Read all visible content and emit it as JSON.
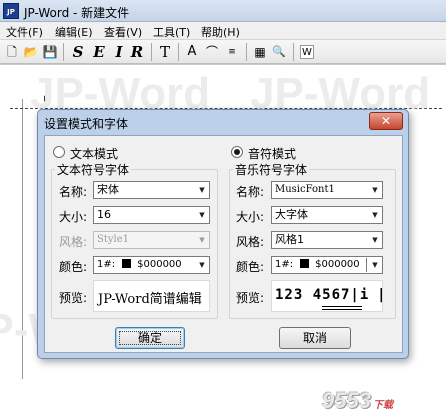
{
  "window": {
    "app_icon_text": "JP",
    "title": "JP-Word - 新建文件"
  },
  "menu": [
    {
      "label": "文件(F)"
    },
    {
      "label": "编辑(E)"
    },
    {
      "label": "查看(V)"
    },
    {
      "label": "工具(T)"
    },
    {
      "label": "帮助(H)"
    }
  ],
  "toolbar": {
    "new_icon": "new-file-icon",
    "new_glyph": "🗋",
    "open_icon": "open-folder-icon",
    "open_glyph": "📂",
    "save_icon": "save-disk-icon",
    "save_glyph": "💾",
    "s_label": "S",
    "e_label": "E",
    "i_label": "I",
    "r_label": "R",
    "t_label": "T",
    "a_label": "A",
    "arc_glyph": "⌒",
    "triplet_glyph": "≡",
    "table_glyph": "▦",
    "zoom_glyph": "🔍",
    "word_glyph": "W"
  },
  "document": {
    "cursor": "↳",
    "watermark": "JP-Word"
  },
  "dialog": {
    "title": "设置模式和字体",
    "close_glyph": "✕",
    "text_mode_label": "文本模式",
    "note_mode_label": "音符模式",
    "text_group_title": "文本符号字体",
    "note_group_title": "音乐符号字体",
    "text_font": {
      "name_label": "名称:",
      "name_value": "宋体",
      "size_label": "大小:",
      "size_value": "16",
      "style_label": "风格:",
      "style_value": "Style1",
      "color_label": "颜色:",
      "color_index": "1#:",
      "color_value": "$000000",
      "preview_label": "预览:",
      "preview_text": "JP-Word简谱编辑"
    },
    "note_font": {
      "name_label": "名称:",
      "name_value": "MusicFont1",
      "size_label": "大小:",
      "size_value": "大字体",
      "style_label": "风格:",
      "style_value": "风格1",
      "color_label": "颜色:",
      "color_index": "1#:",
      "color_value": "$000000",
      "preview_label": "预览:",
      "preview_text": "123 4567|i ‖"
    },
    "ok_label": "确定",
    "cancel_label": "取消"
  },
  "colors": {
    "dialog_frame": "#bcd1e9",
    "close_button": "#c7452f",
    "swatch": "#000000"
  },
  "site_watermark": {
    "main": "9553",
    "suffix": "下载"
  }
}
